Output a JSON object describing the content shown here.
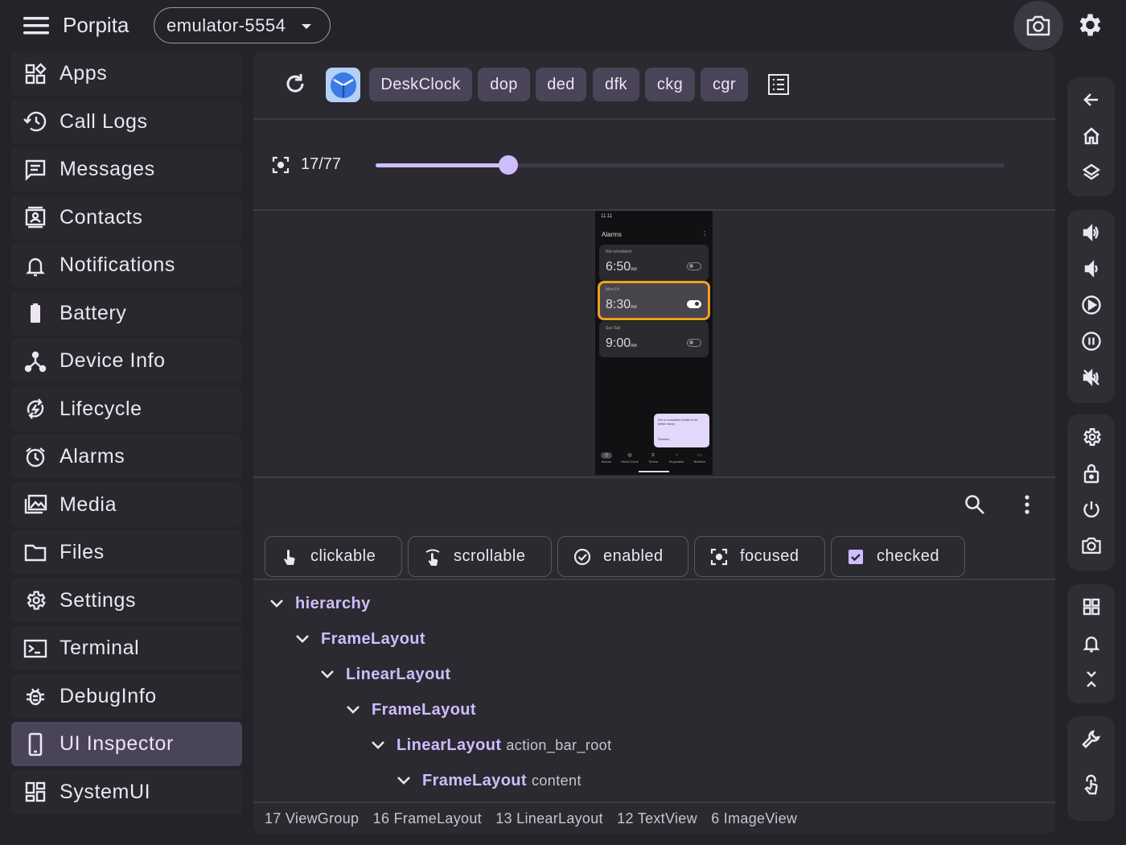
{
  "topbar": {
    "app_title": "Porpita",
    "device": "emulator-5554",
    "icons": [
      "menu-icon",
      "camera-icon",
      "gear-icon"
    ]
  },
  "sidebar": {
    "items": [
      {
        "label": "Apps",
        "icon": "apps-icon"
      },
      {
        "label": "Call Logs",
        "icon": "history-icon"
      },
      {
        "label": "Messages",
        "icon": "message-icon"
      },
      {
        "label": "Contacts",
        "icon": "contacts-icon"
      },
      {
        "label": "Notifications",
        "icon": "bell-icon"
      },
      {
        "label": "Battery",
        "icon": "battery-icon"
      },
      {
        "label": "Device Info",
        "icon": "device-info-icon"
      },
      {
        "label": "Lifecycle",
        "icon": "lifecycle-icon"
      },
      {
        "label": "Alarms",
        "icon": "alarm-icon"
      },
      {
        "label": "Media",
        "icon": "media-icon"
      },
      {
        "label": "Files",
        "icon": "folder-icon"
      },
      {
        "label": "Settings",
        "icon": "settings-icon"
      },
      {
        "label": "Terminal",
        "icon": "terminal-icon"
      },
      {
        "label": "DebugInfo",
        "icon": "bug-icon"
      },
      {
        "label": "UI Inspector",
        "icon": "phone-icon",
        "active": true
      },
      {
        "label": "SystemUI",
        "icon": "dashboard-icon"
      }
    ]
  },
  "inspector": {
    "chips": [
      "DeskClock",
      "dop",
      "ded",
      "dfk",
      "ckg",
      "cgr"
    ],
    "frame_label": "17/77",
    "frame_current": 17,
    "frame_total": 77,
    "filters": [
      "clickable",
      "scrollable",
      "enabled",
      "focused",
      "checked"
    ],
    "tree": [
      {
        "depth": 0,
        "cls": "hierarchy",
        "rid": ""
      },
      {
        "depth": 1,
        "cls": "FrameLayout",
        "rid": ""
      },
      {
        "depth": 2,
        "cls": "LinearLayout",
        "rid": ""
      },
      {
        "depth": 3,
        "cls": "FrameLayout",
        "rid": ""
      },
      {
        "depth": 4,
        "cls": "LinearLayout",
        "rid": "action_bar_root"
      },
      {
        "depth": 5,
        "cls": "FrameLayout",
        "rid": "content"
      }
    ],
    "stats": [
      "17 ViewGroup",
      "16 FrameLayout",
      "13 LinearLayout",
      "12 TextView",
      "6 ImageView"
    ]
  },
  "phone_preview": {
    "status_time": "11:11",
    "header": "Alarms",
    "alarms": [
      {
        "sub": "Not scheduled",
        "time": "6:50",
        "ampm": "AM",
        "on": false
      },
      {
        "sub": "Mon-Fri",
        "time": "8:30",
        "ampm": "AM",
        "on": true
      },
      {
        "sub": "Sun-Sat",
        "time": "9:00",
        "ampm": "AM",
        "on": false
      }
    ],
    "tip": "Set a consistent bedtime for better sleep",
    "tip_action": "Dismiss",
    "tabs": [
      "Alarms",
      "World Clock",
      "Timers",
      "Stopwatch",
      "Bedtime"
    ]
  },
  "colors": {
    "background": "#242329",
    "panel": "#2b2a30",
    "accent": "#cfbcff",
    "chip": "#4a4458",
    "selection": "#f0a020"
  },
  "rail": {
    "groups": [
      [
        "arrow-back-icon",
        "home-icon",
        "layers-icon"
      ],
      [
        "volume-up-icon",
        "volume-down-icon",
        "play-icon",
        "pause-icon",
        "mute-icon"
      ],
      [
        "gear-icon",
        "lock-icon",
        "power-icon",
        "camera-icon"
      ],
      [
        "grid-icon",
        "bell-icon",
        "collapse-icon"
      ],
      [
        "wrench-icon",
        "touch-icon"
      ]
    ]
  }
}
